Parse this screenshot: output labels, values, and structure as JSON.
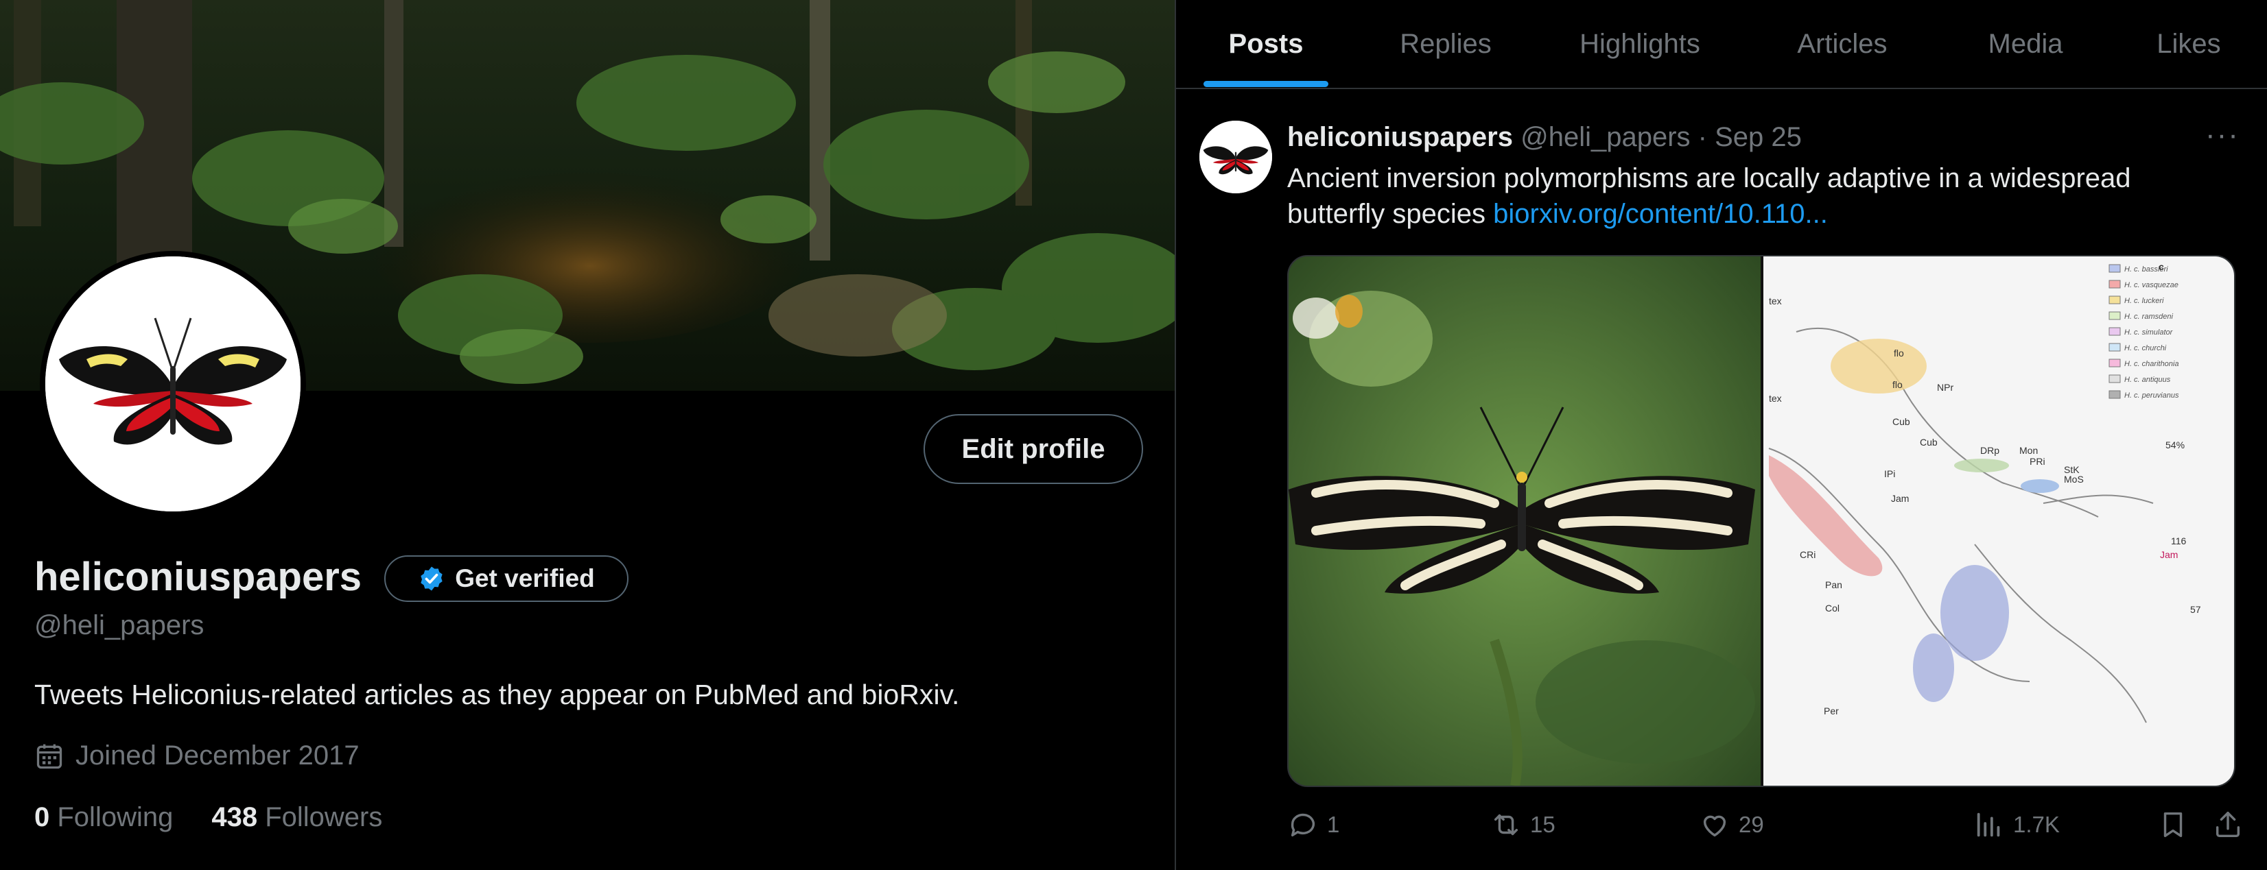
{
  "profile": {
    "display_name": "heliconiuspapers",
    "handle": "@heli_papers",
    "verify_label": "Get verified",
    "edit_label": "Edit profile",
    "bio": "Tweets Heliconius-related articles as they appear on PubMed and bioRxiv.",
    "joined": "Joined December 2017",
    "following_count": "0",
    "following_label": "Following",
    "followers_count": "438",
    "followers_label": "Followers"
  },
  "tabs": [
    {
      "label": "Posts"
    },
    {
      "label": "Replies"
    },
    {
      "label": "Highlights"
    },
    {
      "label": "Articles"
    },
    {
      "label": "Media"
    },
    {
      "label": "Likes"
    }
  ],
  "post": {
    "name": "heliconiuspapers",
    "meta": " @heli_papers · Sep 25",
    "text": "Ancient inversion polymorphisms are locally adaptive in a widespread butterfly species ",
    "link": "biorxiv.org/content/10.110...",
    "more_icon": "···",
    "map_legend": [
      "H. c. bassleri",
      "H. c. vasquezae",
      "H. c. luckeri",
      "H. c. ramsdeni",
      "H. c. simulator",
      "H. c. churchi",
      "H. c. charithonia",
      "H. c. antiquus",
      "H. c. peruvianus"
    ],
    "map_panel_label": "c",
    "map_labels": [
      "tex",
      "flo",
      "flo",
      "NPr",
      "tex",
      "Cub",
      "Cub",
      "DRp",
      "Mon",
      "PRi",
      "IPi",
      "StK",
      "MoS",
      "Jam",
      "Jam",
      "CRi",
      "Pan",
      "Col",
      "Per",
      "54%",
      "116",
      "57"
    ],
    "replies": "1",
    "reposts": "15",
    "likes": "29",
    "views": "1.7K"
  },
  "colors": {
    "accent": "#1d9bf0",
    "text_primary": "#e7e9ea",
    "text_secondary": "#71767b",
    "border": "#2f3336",
    "background": "#000000"
  },
  "icons": [
    "calendar-icon",
    "verified-badge-icon",
    "reply-icon",
    "repost-icon",
    "like-icon",
    "views-icon",
    "bookmark-icon",
    "share-icon",
    "more-icon"
  ]
}
